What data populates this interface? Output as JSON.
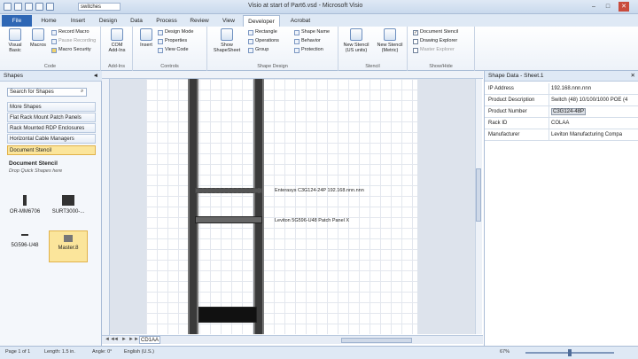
{
  "titlebar": {
    "filename": "switches",
    "title": "Visio at start of Part6.vsd - Microsoft Visio",
    "minimize": "–",
    "restore": "□",
    "close": "✕"
  },
  "tabs": [
    {
      "label": "File"
    },
    {
      "label": "Home"
    },
    {
      "label": "Insert"
    },
    {
      "label": "Design"
    },
    {
      "label": "Data"
    },
    {
      "label": "Process"
    },
    {
      "label": "Review"
    },
    {
      "label": "View"
    },
    {
      "label": "Developer"
    },
    {
      "label": "Acrobat"
    }
  ],
  "ribbon": {
    "code": {
      "label": "Code",
      "visual_basic": "Visual Basic",
      "macros": "Macros",
      "record_macro": "Record Macro",
      "pause_recording": "Pause Recording",
      "macro_security": "Macro Security"
    },
    "addins": {
      "label": "Add-Ins",
      "com_addins": "COM Add-Ins"
    },
    "controls": {
      "label": "Controls",
      "insert": "Insert",
      "design_mode": "Design Mode",
      "properties": "Properties",
      "view_code": "View Code"
    },
    "shape_design": {
      "label": "Shape Design",
      "show_shapesheet": "Show ShapeSheet",
      "rectangle": "Rectangle",
      "operations": "Operations",
      "group": "Group",
      "shape_name": "Shape Name",
      "behavior": "Behavior",
      "protection": "Protection"
    },
    "stencil": {
      "label": "Stencil",
      "new_us": "New Stencil (US units)",
      "new_metric": "New Stencil (Metric)"
    },
    "show_hide": {
      "label": "Show/Hide",
      "document_stencil": "Document Stencil",
      "drawing_explorer": "Drawing Explorer",
      "master_explorer": "Master Explorer"
    }
  },
  "shapes_pane": {
    "title": "Shapes",
    "search_placeholder": "Search for Shapes",
    "stencils": [
      {
        "label": "More Shapes"
      },
      {
        "label": "Flat Rack Mount Patch Panels"
      },
      {
        "label": "Rack Mounted RDP Enclosures"
      },
      {
        "label": "Horizontal Cable Managers"
      },
      {
        "label": "Document Stencil"
      }
    ],
    "doc_stencil_title": "Document Stencil",
    "drop_quick": "Drop Quick Shapes here",
    "masters": [
      {
        "label": "OR-MM6706"
      },
      {
        "label": "SURT3000-..."
      },
      {
        "label": "5G596-U48"
      },
      {
        "label": "Master.8"
      }
    ]
  },
  "canvas": {
    "callouts": [
      {
        "text": "Enterasys C3G124-24P 192.168.nnn.nnn"
      },
      {
        "text": "Leviton 5G596-U48 Patch Panel X"
      }
    ],
    "page_tab": "CD1AA",
    "nav": [
      "◄◄",
      "◄",
      "►",
      "►►"
    ]
  },
  "shape_data": {
    "title": "Shape Data - Sheet.1",
    "rows": [
      {
        "label": "IP Address",
        "value": "192.168.nnn.nnn"
      },
      {
        "label": "Product Description",
        "value": "Switch (48) 10/100/1000 POE (4"
      },
      {
        "label": "Product Number",
        "value": "C3G124-48P"
      },
      {
        "label": "Rack ID",
        "value": "COLAA"
      },
      {
        "label": "Manufacturer",
        "value": "Leviton Manufacturing Compa"
      }
    ]
  },
  "statusbar": {
    "page": "Page 1 of 1",
    "length": "Length: 1.5 in.",
    "angle": "Angle: 0°",
    "language": "English (U.S.)",
    "zoom": "67%"
  }
}
